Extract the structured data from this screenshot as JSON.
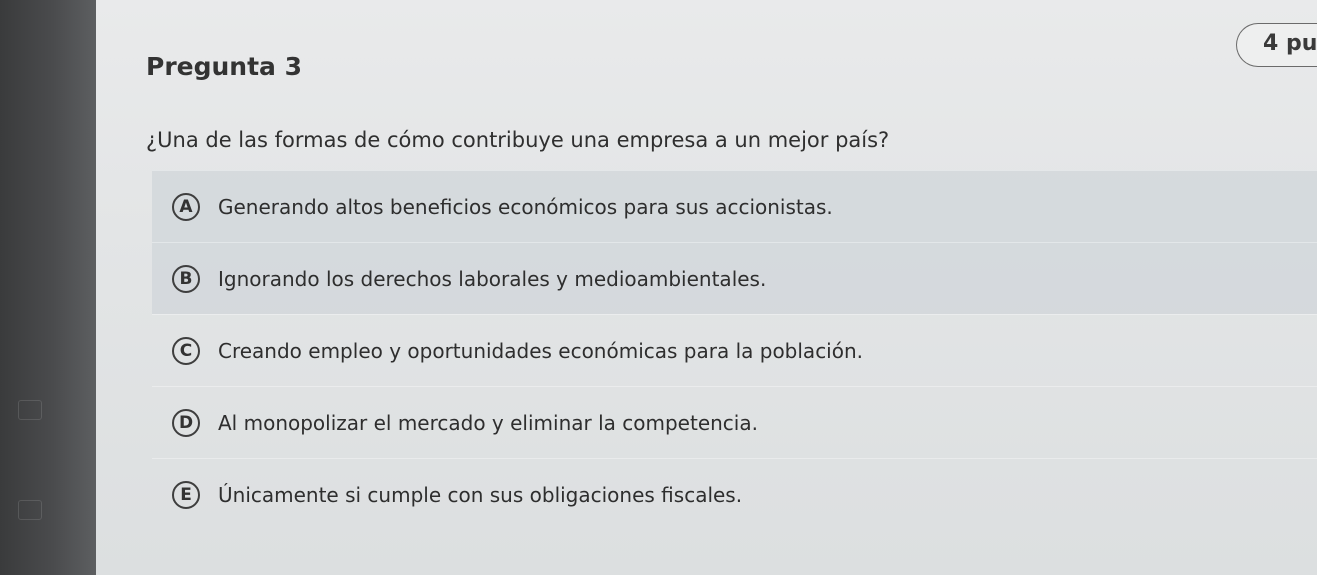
{
  "question": {
    "title": "Pregunta 3",
    "points": "4 pu",
    "text": "¿Una de las formas de cómo contribuye una empresa a un mejor país?"
  },
  "options": [
    {
      "letter": "A",
      "text": "Generando altos beneficios económicos para sus accionistas."
    },
    {
      "letter": "B",
      "text": "Ignorando los derechos laborales y medioambientales."
    },
    {
      "letter": "C",
      "text": "Creando empleo y oportunidades económicas para la población."
    },
    {
      "letter": "D",
      "text": "Al monopolizar el mercado y eliminar la competencia."
    },
    {
      "letter": "E",
      "text": "Únicamente si cumple con sus obligaciones fiscales."
    }
  ]
}
